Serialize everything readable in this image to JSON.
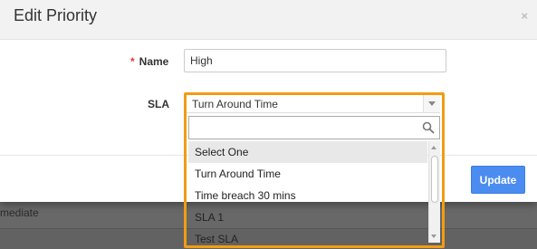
{
  "background": {
    "row_text": "mediate"
  },
  "modal": {
    "title": "Edit Priority",
    "close_label": "×",
    "name": {
      "required_mark": "*",
      "label": "Name",
      "value": "High"
    },
    "sla": {
      "label": "SLA",
      "selected": "Turn Around Time",
      "search_value": "",
      "options": [
        {
          "label": "Select One",
          "highlighted": true
        },
        {
          "label": "Turn Around Time",
          "highlighted": false
        },
        {
          "label": "Time breach 30 mins",
          "highlighted": false
        },
        {
          "label": "SLA 1",
          "highlighted": false
        },
        {
          "label": "Test SLA",
          "highlighted": false
        }
      ]
    },
    "update_label": "Update"
  },
  "colors": {
    "accent_outline": "#f39c12",
    "primary_button": "#4a8cf0",
    "required": "#e53935"
  }
}
